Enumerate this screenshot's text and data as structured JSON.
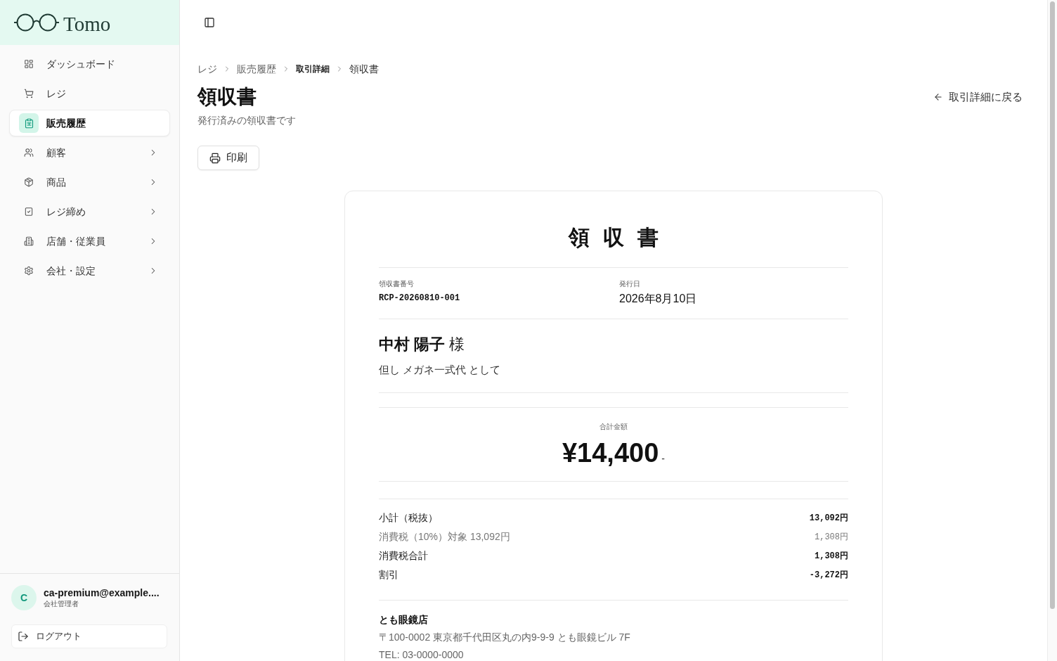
{
  "sidebar": {
    "logo": "Tomo",
    "nav_items": [
      {
        "label": "ダッシュボード",
        "selected": false,
        "expandable": false
      },
      {
        "label": "レジ",
        "selected": false,
        "expandable": false
      },
      {
        "label": "販売履歴",
        "selected": true,
        "expandable": false
      },
      {
        "label": "顧客",
        "selected": false,
        "expandable": true
      },
      {
        "label": "商品",
        "selected": false,
        "expandable": true
      },
      {
        "label": "レジ締め",
        "selected": false,
        "expandable": true
      },
      {
        "label": "店舗・従業員",
        "selected": false,
        "expandable": true
      },
      {
        "label": "会社・設定",
        "selected": false,
        "expandable": true
      }
    ],
    "user": {
      "avatar_initial": "C",
      "email": "ca-premium@example....",
      "role": "会社管理者"
    },
    "logout_button": "ログアウト"
  },
  "breadcrumb": [
    {
      "label": "レジ",
      "kind": "link"
    },
    {
      "label": "販売履歴",
      "kind": "link"
    },
    {
      "label": "取引詳細",
      "kind": "emphasis"
    },
    {
      "label": "領収書",
      "kind": "current"
    }
  ],
  "page_header": {
    "title": "領収書",
    "subtitle": "発行済みの領収書です",
    "back_link": "取引詳細に戻る",
    "print_button": "印刷"
  },
  "receipt": {
    "title": "領 収 書",
    "fields": [
      {
        "label": "領収書番号",
        "value": "RCP-20260810-001",
        "kind": "code"
      },
      {
        "label": "発行日",
        "value": "2026年8月10日",
        "kind": "text"
      }
    ],
    "recipient": {
      "name": "中村 陽子",
      "honorific": "様"
    },
    "purpose": "但し メガネ一式代 として",
    "total": {
      "label": "合計金額",
      "amount": "¥14,400",
      "suffix": "-"
    },
    "breakdown": [
      {
        "label": "小計（税抜）",
        "value": "13,092円",
        "muted": false
      },
      {
        "label": "消費税（10%）対象 13,092円",
        "value": "1,308円",
        "muted": true
      },
      {
        "label": "消費税合計",
        "value": "1,308円",
        "muted": false
      },
      {
        "label": "割引",
        "value": "-3,272円",
        "muted": false
      }
    ],
    "store": {
      "name": "とも眼鏡店",
      "address": "〒100-0002 東京都千代田区丸の内9-9-9 とも眼鏡ビル 7F",
      "tel": "TEL: 03-0000-0000"
    }
  }
}
